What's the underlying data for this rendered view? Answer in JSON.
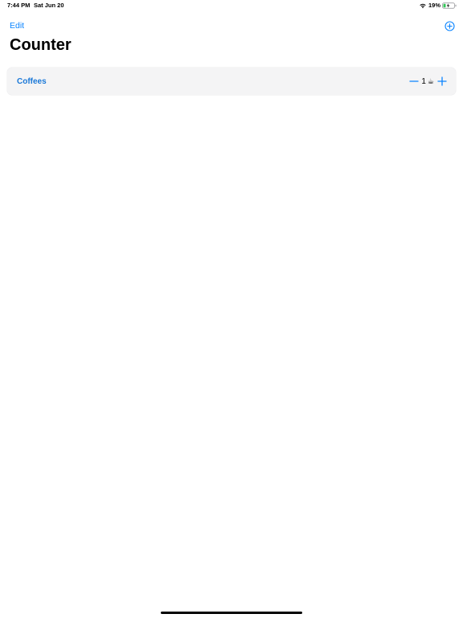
{
  "status_bar": {
    "time": "7:44 PM",
    "date": "Sat Jun 20",
    "battery_percent": "19%",
    "wifi_icon": "wifi-icon",
    "battery_icon": "battery-charging-icon"
  },
  "nav": {
    "edit_label": "Edit",
    "add_icon": "plus-circle-icon"
  },
  "title": "Counter",
  "counters": [
    {
      "label": "Coffees",
      "count": "1",
      "emoji": "☕",
      "decrement_icon": "minus-icon",
      "increment_icon": "plus-icon"
    }
  ],
  "colors": {
    "accent": "#0a84ff",
    "row_background": "#f4f4f5"
  }
}
